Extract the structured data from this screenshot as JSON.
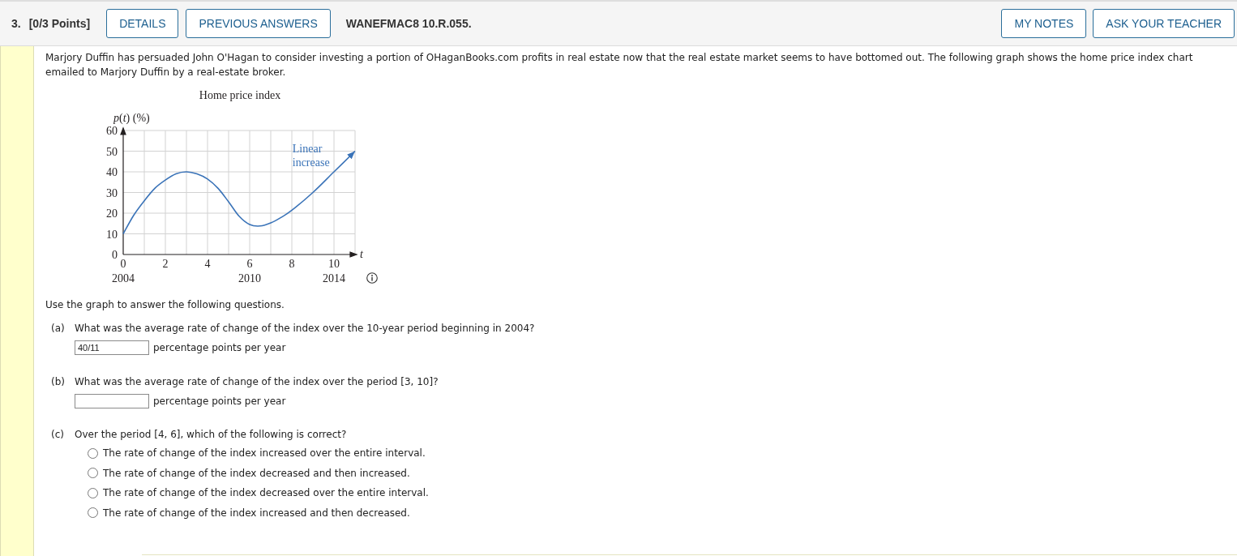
{
  "question_header": {
    "number": "3.",
    "points": "[0/3 Points]",
    "left_buttons": [
      "DETAILS",
      "PREVIOUS ANSWERS"
    ],
    "code": "WANEFMAC8 10.R.055.",
    "right_buttons": [
      "MY NOTES",
      "ASK YOUR TEACHER"
    ]
  },
  "problem": {
    "text": "Marjory Duffin has persuaded John O'Hagan to consider investing a portion of OHaganBooks.com profits in real estate now that the real estate market seems to have bottomed out. The following graph shows the home price index chart emailed to Marjory Duffin by a real-estate broker.",
    "graph": {
      "chart_data": {
        "type": "line",
        "title": "Home price index",
        "xlabel": "t",
        "ylabel": "*p*(*t*) (%)",
        "x": [
          0,
          0.5,
          1,
          1.5,
          2,
          2.5,
          3,
          3.5,
          4,
          4.5,
          5,
          5.5,
          6,
          6.5,
          7,
          7.5,
          8,
          9,
          10,
          11
        ],
        "values": [
          10,
          19,
          26,
          32,
          36,
          39,
          40,
          39,
          36.5,
          32,
          25.5,
          18.5,
          14.5,
          13.8,
          15.3,
          18,
          21.4,
          30,
          40,
          50
        ],
        "xlim": [
          0,
          11
        ],
        "ylim": [
          0,
          60
        ],
        "xticks": [
          0,
          2,
          4,
          6,
          8,
          10
        ],
        "yticks": [
          0,
          10,
          20,
          30,
          40,
          50,
          60
        ],
        "grid": true,
        "annotations": [
          "Linear increase",
          "2004",
          "2010",
          "2014"
        ]
      }
    }
  },
  "instruction": "Use the graph to answer the following questions.",
  "parts": [
    {
      "kind": "input",
      "letter": "(a)",
      "question": "What was the average rate of change of the index over the 10-year period beginning in 2004?",
      "value": "40/11",
      "unit": "percentage points per year"
    },
    {
      "kind": "input",
      "letter": "(b)",
      "question": "What was the average rate of change of the index over the period [3, 10]?",
      "unit": "percentage points per year"
    },
    {
      "kind": "choice",
      "letter": "(c)",
      "question": "Over the period [4, 6], which of the following is correct?",
      "options": [
        {
          "label": "The rate of change of the index increased over the entire interval.",
          "selected": false
        },
        {
          "label": "The rate of change of the index decreased and then increased.",
          "selected": false
        },
        {
          "label": "The rate of change of the index decreased over the entire interval.",
          "selected": false
        },
        {
          "label": "The rate of change of the index increased and then decreased.",
          "selected": false
        }
      ]
    }
  ]
}
